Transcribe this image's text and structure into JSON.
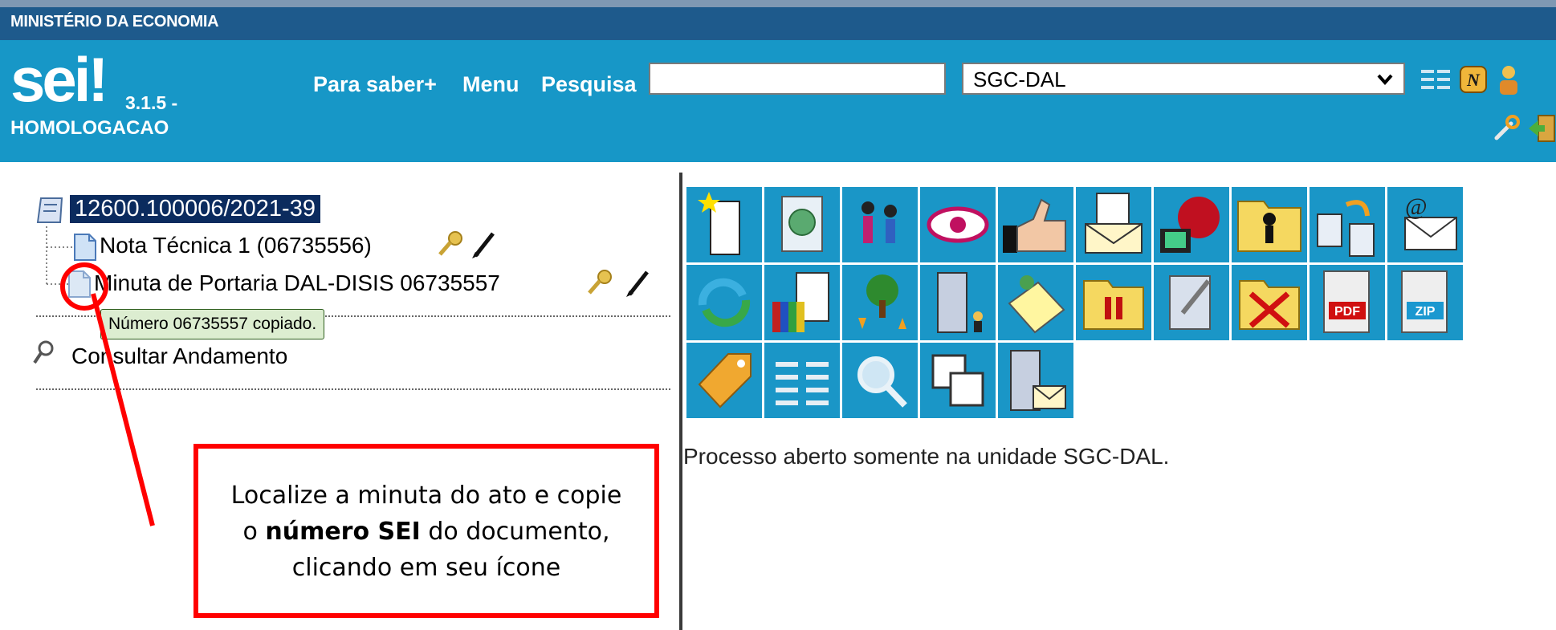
{
  "header": {
    "ministry": "MINISTÉRIO DA ECONOMIA",
    "logo": "sei!",
    "version": "3.1.5 -",
    "environment": "HOMOLOGACAO",
    "nav": [
      "Para saber+",
      "Menu",
      "Pesquisa"
    ],
    "search_value": "",
    "unit_selected": "SGC-DAL",
    "icons": [
      "list-icon",
      "notification-n-icon",
      "user-icon",
      "wrench-icon",
      "exit-icon"
    ]
  },
  "tree": {
    "process_number": "12600.100006/2021-39",
    "documents": [
      {
        "label": "Nota Técnica 1 (06735556)"
      },
      {
        "label": "Minuta de Portaria DAL-DISIS 06735557"
      }
    ],
    "consult_label": "Consultar Andamento",
    "tooltip": "Número 06735557 copiado."
  },
  "toolbar": {
    "tiles": [
      "new-document-icon",
      "start-related-process-icon",
      "send-process-icon",
      "view-icon",
      "approve-icon",
      "send-email-icon",
      "sync-icon",
      "assign-user-icon",
      "copy-document-icon",
      "email-icon",
      "refresh-icon",
      "attach-books-icon",
      "move-process-icon",
      "building-user-icon",
      "notes-icon",
      "suspend-icon",
      "sign-icon",
      "cancel-icon",
      "pdf-icon",
      "zip-icon",
      "tag-icon",
      "list-icon",
      "search-icon",
      "relate-icon",
      "building-mail-icon"
    ]
  },
  "status": {
    "text": "Processo aberto somente na unidade SGC-DAL."
  },
  "annotation": {
    "line1": "Localize a minuta do ato e copie",
    "line2_prefix": "o ",
    "line2_bold": "número SEI",
    "line2_suffix": " do documento,",
    "line3": "clicando em seu ícone"
  },
  "colors": {
    "header_bg": "#1797c7",
    "ministry_bg": "#1e5a8c",
    "tile_bg": "#1a96c7",
    "highlight": "#0b2b5e",
    "annotation_red": "#ff0000"
  }
}
